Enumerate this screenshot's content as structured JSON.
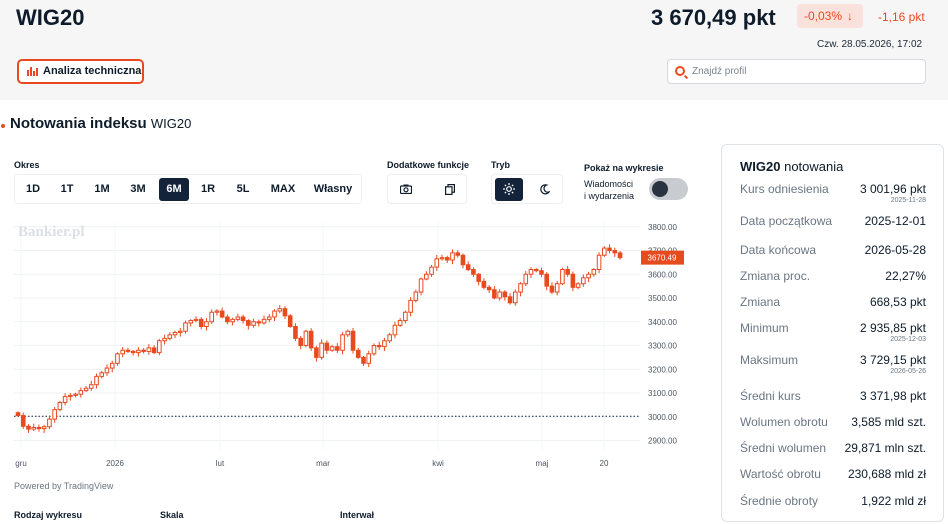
{
  "header": {
    "ticker": "WIG20",
    "price": "3 670,49 pkt",
    "change_pct": "-0,03%",
    "change_abs": "-1,16 pkt",
    "datetime": "Czw. 28.05.2026, 17:02",
    "analiza_label": "Analiza techniczna",
    "search_placeholder": "Znajdź profil"
  },
  "section": {
    "title": "Notowania indeksu",
    "subtitle": "WIG20"
  },
  "controls": {
    "okres_label": "Okres",
    "periods": [
      "1D",
      "1T",
      "1M",
      "3M",
      "6M",
      "1R",
      "5L",
      "MAX",
      "Własny"
    ],
    "active_period": "6M",
    "dodatkowe_label": "Dodatkowe funkcje",
    "tryb_label": "Tryb",
    "pokaz_label": "Pokaż na wykresie",
    "wydarzenia_line1": "Wiadomości",
    "wydarzenia_line2": "i wydarzenia",
    "icons": [
      "camera-icon",
      "copy-icon",
      "sun-icon",
      "moon-icon"
    ]
  },
  "chart_data": {
    "type": "candlestick",
    "watermark": "Bankier.pl",
    "x_ticks": [
      "gru",
      "2026",
      "lut",
      "mar",
      "kwi",
      "maj",
      "20"
    ],
    "y_ticks": [
      "3800.00",
      "3700.00",
      "3600.00",
      "3500.00",
      "3400.00",
      "3300.00",
      "3200.00",
      "3100.00",
      "3000.00",
      "2900.00"
    ],
    "ylim": [
      2860,
      3820
    ],
    "reference_line": 3001.96,
    "last_price_label": "3670.49",
    "close_series": [
      3005,
      2960,
      2948,
      2955,
      2950,
      2958,
      2990,
      3030,
      3060,
      3085,
      3090,
      3095,
      3110,
      3120,
      3135,
      3170,
      3185,
      3205,
      3225,
      3265,
      3280,
      3275,
      3270,
      3280,
      3275,
      3290,
      3270,
      3320,
      3330,
      3345,
      3355,
      3360,
      3395,
      3405,
      3410,
      3380,
      3400,
      3440,
      3445,
      3420,
      3400,
      3410,
      3420,
      3405,
      3385,
      3400,
      3395,
      3410,
      3420,
      3445,
      3455,
      3425,
      3380,
      3330,
      3300,
      3360,
      3290,
      3250,
      3310,
      3280,
      3295,
      3280,
      3345,
      3360,
      3280,
      3250,
      3225,
      3265,
      3300,
      3295,
      3320,
      3345,
      3385,
      3405,
      3440,
      3490,
      3525,
      3580,
      3600,
      3630,
      3665,
      3670,
      3660,
      3690,
      3680,
      3640,
      3620,
      3600,
      3570,
      3545,
      3535,
      3500,
      3525,
      3505,
      3480,
      3525,
      3560,
      3600,
      3620,
      3615,
      3600,
      3550,
      3525,
      3560,
      3620,
      3600,
      3545,
      3560,
      3585,
      3600,
      3620,
      3680,
      3710,
      3700,
      3690,
      3670
    ],
    "powered_by": "Powered by TradingView"
  },
  "bottom_labels": [
    "Rodzaj wykresu",
    "Skala",
    "Interwał"
  ],
  "panel": {
    "title_bold": "WIG20",
    "title_rest": "notowania",
    "rows": [
      {
        "k": "Kurs odniesienia",
        "v": "3 001,96 pkt",
        "d": "2025-11-28"
      },
      {
        "k": "Data początkowa",
        "v": "2025-12-01",
        "d": ""
      },
      {
        "k": "Data końcowa",
        "v": "2026-05-28",
        "d": ""
      },
      {
        "k": "Zmiana proc.",
        "v": "22,27%",
        "d": ""
      },
      {
        "k": "Zmiana",
        "v": "668,53 pkt",
        "d": ""
      },
      {
        "k": "Minimum",
        "v": "2 935,85 pkt",
        "d": "2025-12-03"
      },
      {
        "k": "Maksimum",
        "v": "3 729,15 pkt",
        "d": "2026-05-26"
      },
      {
        "k": "Średni kurs",
        "v": "3 371,98 pkt",
        "d": ""
      },
      {
        "k": "Wolumen obrotu",
        "v": "3,585 mld szt.",
        "d": ""
      },
      {
        "k": "Średni wolumen",
        "v": "29,871 mln szt.",
        "d": ""
      },
      {
        "k": "Wartość obrotu",
        "v": "230,688 mld zł",
        "d": ""
      },
      {
        "k": "Średnie obroty",
        "v": "1,922 mld zł",
        "d": ""
      }
    ]
  },
  "colors": {
    "accent": "#e84a1f",
    "navy": "#13233a",
    "candle": "#e84a1f"
  }
}
